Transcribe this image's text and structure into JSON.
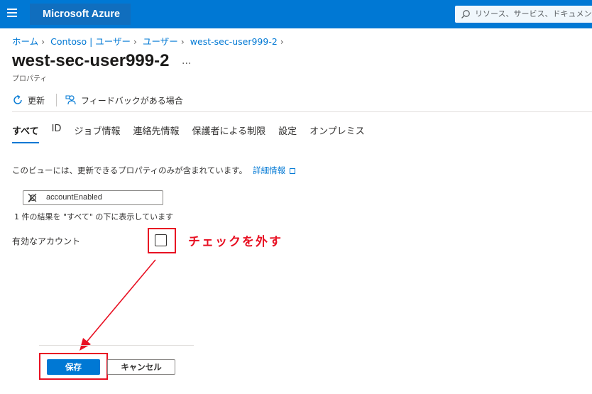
{
  "header": {
    "brand": "Microsoft Azure",
    "search_placeholder": "リソース、サービス、ドキュメントの検索"
  },
  "breadcrumb": [
    "ホーム",
    "Contoso | ユーザー",
    "ユーザー",
    "west-sec-user999-2"
  ],
  "page": {
    "title": "west-sec-user999-2",
    "more": "...",
    "subtitle": "プロパティ"
  },
  "commands": {
    "refresh": "更新",
    "feedback": "フィードバックがある場合"
  },
  "tabs": [
    "すべて",
    "ID",
    "ジョブ情報",
    "連絡先情報",
    "保護者による制限",
    "設定",
    "オンプレミス"
  ],
  "info": {
    "text": "このビューには、更新できるプロパティのみが含まれています。",
    "link": "詳細情報"
  },
  "filter": {
    "value": "accountEnabled",
    "result": "1 件の結果を \"すべて\" の下に表示しています"
  },
  "field": {
    "label": "有効なアカウント",
    "checked": false
  },
  "annotation": "チェックを外す",
  "buttons": {
    "save": "保存",
    "cancel": "キャンセル"
  },
  "colors": {
    "accent": "#0078d4",
    "annotation": "#e81123"
  }
}
